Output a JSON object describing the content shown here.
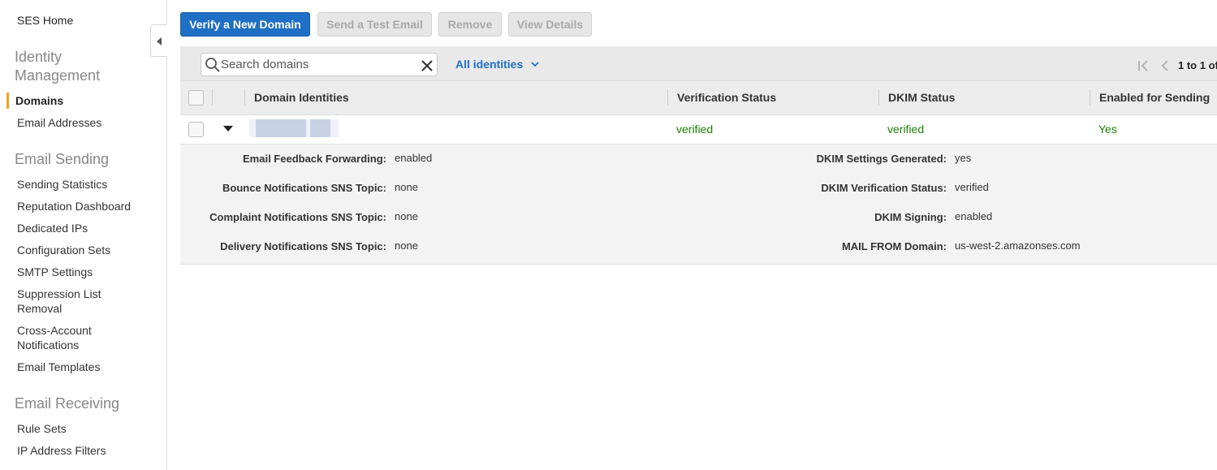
{
  "sidebar": {
    "home": "SES Home",
    "sections": [
      {
        "title": "Identity Management",
        "items": [
          "Domains",
          "Email Addresses"
        ]
      },
      {
        "title": "Email Sending",
        "items": [
          "Sending Statistics",
          "Reputation Dashboard",
          "Dedicated IPs",
          "Configuration Sets",
          "SMTP Settings",
          "Suppression List Removal",
          "Cross-Account Notifications",
          "Email Templates"
        ]
      },
      {
        "title": "Email Receiving",
        "items": [
          "Rule Sets",
          "IP Address Filters"
        ]
      }
    ],
    "active_item": "Domains",
    "accent_color": "#f0a31d"
  },
  "toolbar": {
    "verify_label": "Verify a New Domain",
    "send_test_label": "Send a Test Email",
    "remove_label": "Remove",
    "view_details_label": "View Details"
  },
  "filter": {
    "search_placeholder": "Search domains",
    "identity_filter": "All identities",
    "pager_text": "1 to 1 of"
  },
  "table": {
    "columns": [
      "Domain Identities",
      "Verification Status",
      "DKIM Status",
      "Enabled for Sending"
    ],
    "rows": [
      {
        "domain": "",
        "verification_status": "verified",
        "dkim_status": "verified",
        "enabled_for_sending": "Yes"
      }
    ]
  },
  "details": {
    "left": [
      {
        "label": "Email Feedback Forwarding:",
        "value": "enabled"
      },
      {
        "label": "Bounce Notifications SNS Topic:",
        "value": "none"
      },
      {
        "label": "Complaint Notifications SNS Topic:",
        "value": "none"
      },
      {
        "label": "Delivery Notifications SNS Topic:",
        "value": "none"
      }
    ],
    "right": [
      {
        "label": "DKIM Settings Generated:",
        "value": "yes"
      },
      {
        "label": "DKIM Verification Status:",
        "value": "verified"
      },
      {
        "label": "DKIM Signing:",
        "value": "enabled"
      },
      {
        "label": "MAIL FROM Domain:",
        "value": "us-west-2.amazonses.com"
      }
    ]
  },
  "colors": {
    "primary": "#1f6fc5",
    "status_green": "#1d8102"
  }
}
